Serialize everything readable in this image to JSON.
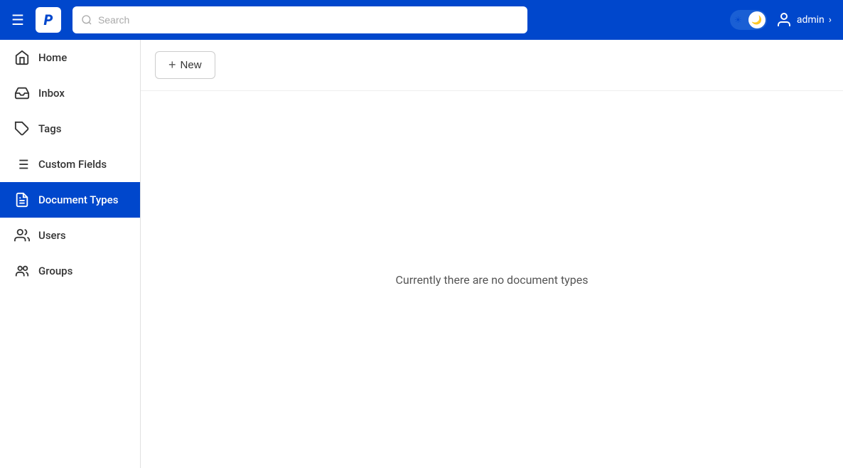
{
  "header": {
    "logo_text": "P",
    "search_placeholder": "Search",
    "user_name": "admin",
    "theme_icon": "🌙"
  },
  "sidebar": {
    "items": [
      {
        "id": "home",
        "label": "Home",
        "icon": "home",
        "active": false
      },
      {
        "id": "inbox",
        "label": "Inbox",
        "icon": "inbox",
        "active": false
      },
      {
        "id": "tags",
        "label": "Tags",
        "icon": "tag",
        "active": false
      },
      {
        "id": "custom-fields",
        "label": "Custom Fields",
        "icon": "menu",
        "active": false
      },
      {
        "id": "document-types",
        "label": "Document Types",
        "icon": "document",
        "active": true
      },
      {
        "id": "users",
        "label": "Users",
        "icon": "users",
        "active": false
      },
      {
        "id": "groups",
        "label": "Groups",
        "icon": "groups",
        "active": false
      }
    ]
  },
  "toolbar": {
    "new_button_label": "New",
    "new_button_plus": "+"
  },
  "main": {
    "empty_message": "Currently there are no document types"
  }
}
